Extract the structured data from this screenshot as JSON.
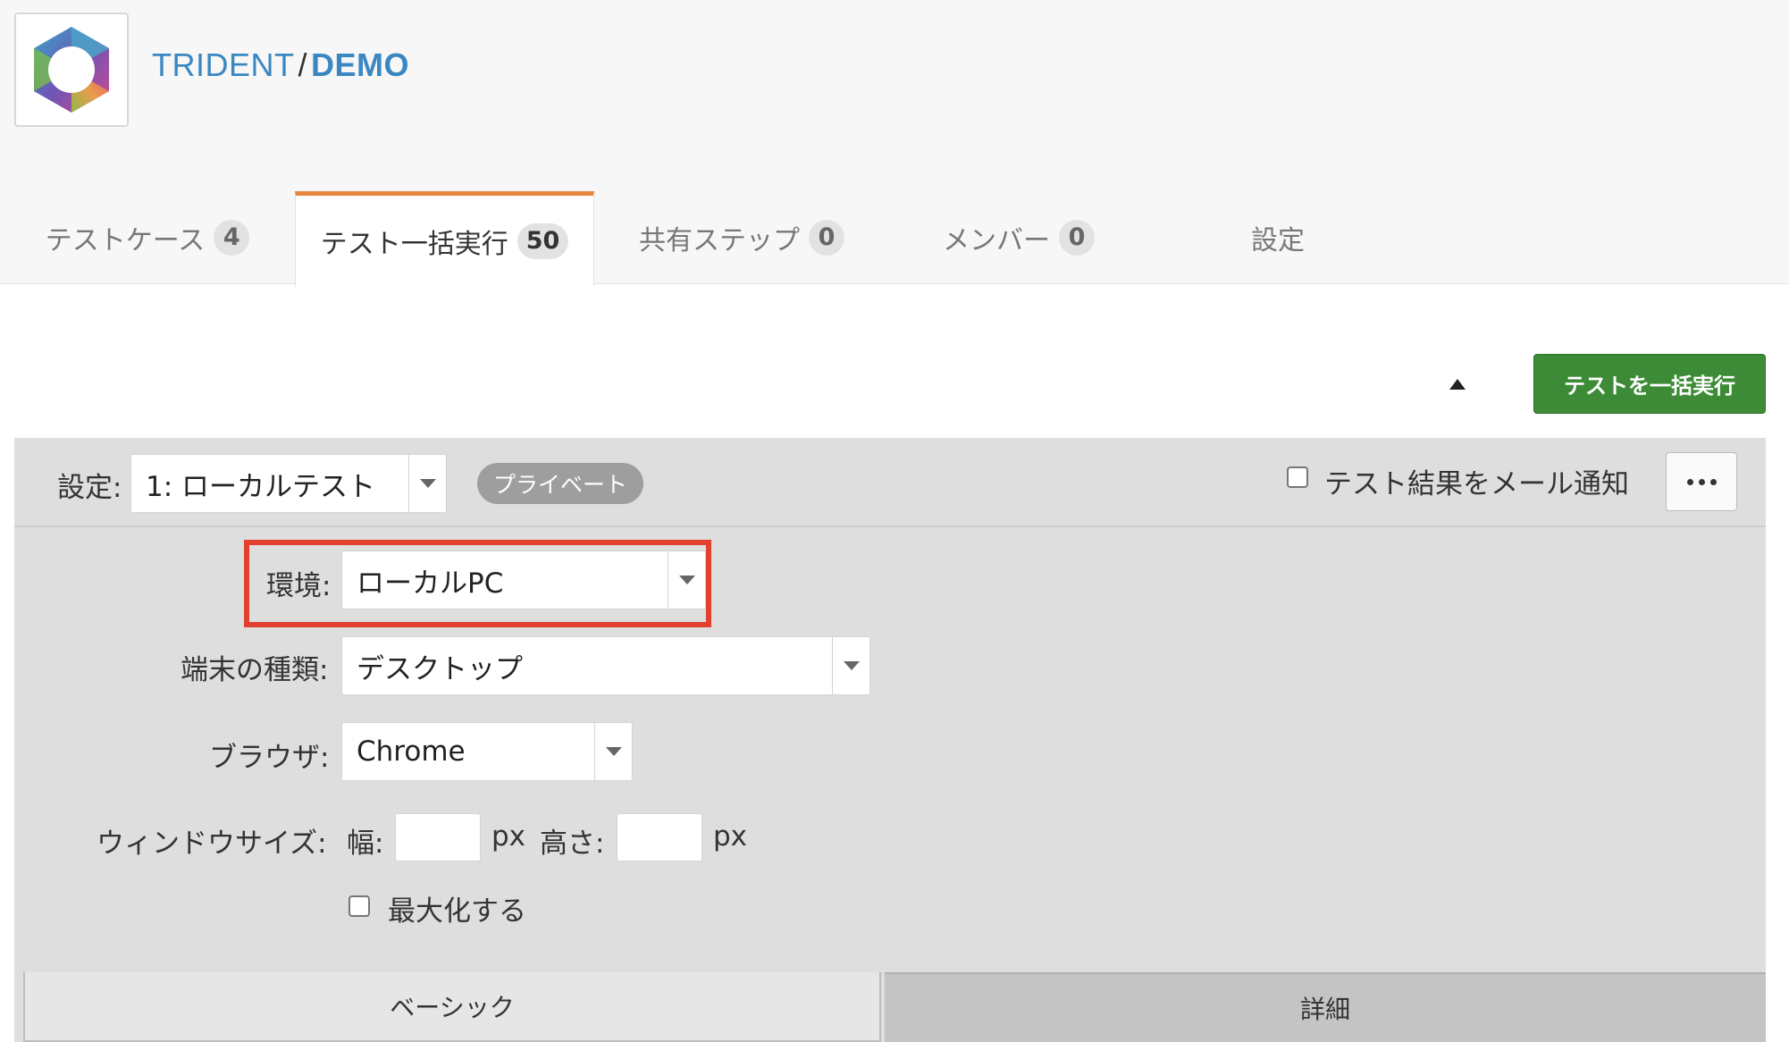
{
  "header": {
    "org": "TRIDENT",
    "separator": "/",
    "project": "DEMO"
  },
  "tabs": [
    {
      "label": "テストケース",
      "count": "4"
    },
    {
      "label": "テスト一括実行",
      "count": "50",
      "active": true
    },
    {
      "label": "共有ステップ",
      "count": "0"
    },
    {
      "label": "メンバー",
      "count": "0"
    },
    {
      "label": "設定"
    }
  ],
  "toolbar": {
    "collapse_icon": "triangle-up-icon",
    "run_all_label": "テストを一括実行"
  },
  "settings": {
    "label": "設定:",
    "selected": "1: ローカルテスト",
    "visibility_badge": "プライベート",
    "email_notify_label": "テスト結果をメール通知",
    "email_notify_checked": false,
    "more_icon": "ellipsis-icon"
  },
  "form": {
    "environment_label": "環境:",
    "environment_value": "ローカルPC",
    "device_label": "端末の種類:",
    "device_value": "デスクトップ",
    "browser_label": "ブラウザ:",
    "browser_value": "Chrome",
    "window_size_label": "ウィンドウサイズ:",
    "width_label": "幅:",
    "width_value": "",
    "width_unit": "px",
    "height_label": "高さ:",
    "height_value": "",
    "height_unit": "px",
    "maximize_label": "最大化する",
    "maximize_checked": false
  },
  "bottom_tabs": {
    "basic": "ベーシック",
    "details": "詳細"
  },
  "colors": {
    "accent_tab": "#e8853c",
    "brand_blue": "#3a87c2",
    "run_button": "#3d8b36",
    "highlight": "#e2412f"
  }
}
